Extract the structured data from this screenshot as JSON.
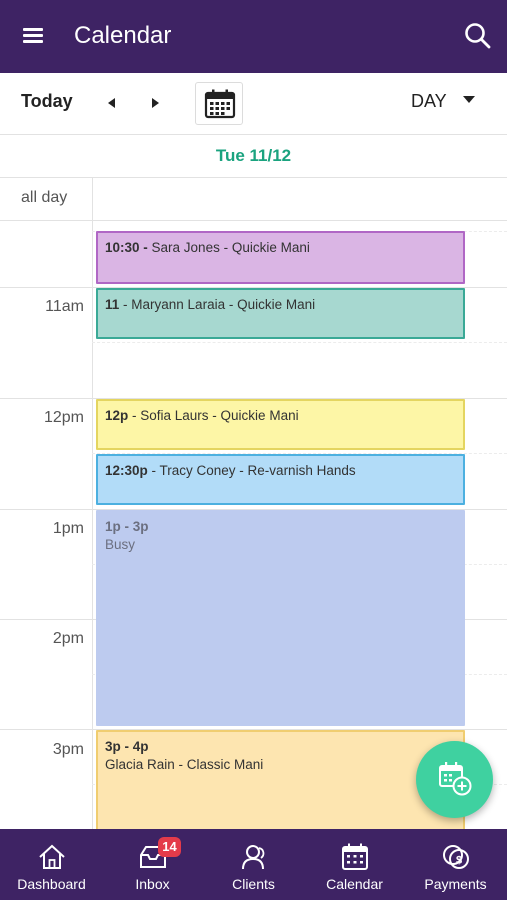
{
  "header": {
    "title": "Calendar"
  },
  "toolbar": {
    "today_label": "Today",
    "view_label": "DAY"
  },
  "date_header": {
    "date": "Tue 11/12"
  },
  "allday": {
    "label": "all day"
  },
  "hours": [
    "11am",
    "12pm",
    "1pm",
    "2pm",
    "3pm"
  ],
  "events": [
    {
      "time": "10:30 -",
      "text": " Sara Jones - Quickie Mani",
      "sub": "",
      "color": "#dab5e4",
      "border": "#b067c5"
    },
    {
      "time": "11",
      "text": " - Maryann Laraia - Quickie Mani",
      "sub": "",
      "color": "#a7d8d0",
      "border": "#3aa996"
    },
    {
      "time": "12p",
      "text": " - Sofia Laurs - Quickie Mani",
      "sub": "",
      "color": "#fdf6a6",
      "border": "#e4d560"
    },
    {
      "time": "12:30p",
      "text": " - Tracy Coney - Re-varnish Hands",
      "sub": "",
      "color": "#b2dcf8",
      "border": "#4cb0e0"
    },
    {
      "time": "1p - 3p",
      "text": "",
      "sub": "Busy",
      "color": "#bdcbef",
      "border": "#bdcbef"
    },
    {
      "time": "3p - 4p",
      "text": "",
      "sub": "Glacia Rain - Classic Mani",
      "color": "#fde5b0",
      "border": "#f0cd70"
    }
  ],
  "nav": [
    {
      "label": "Dashboard",
      "icon": "home-icon"
    },
    {
      "label": "Inbox",
      "icon": "inbox-icon"
    },
    {
      "label": "Clients",
      "icon": "clients-icon"
    },
    {
      "label": "Calendar",
      "icon": "calendar-icon"
    },
    {
      "label": "Payments",
      "icon": "payments-icon"
    }
  ],
  "inbox_badge": "14",
  "colors": {
    "brand": "#3e2364",
    "accent": "#1aa37f",
    "fab": "#3fd1a0",
    "badge": "#e43b4a"
  }
}
